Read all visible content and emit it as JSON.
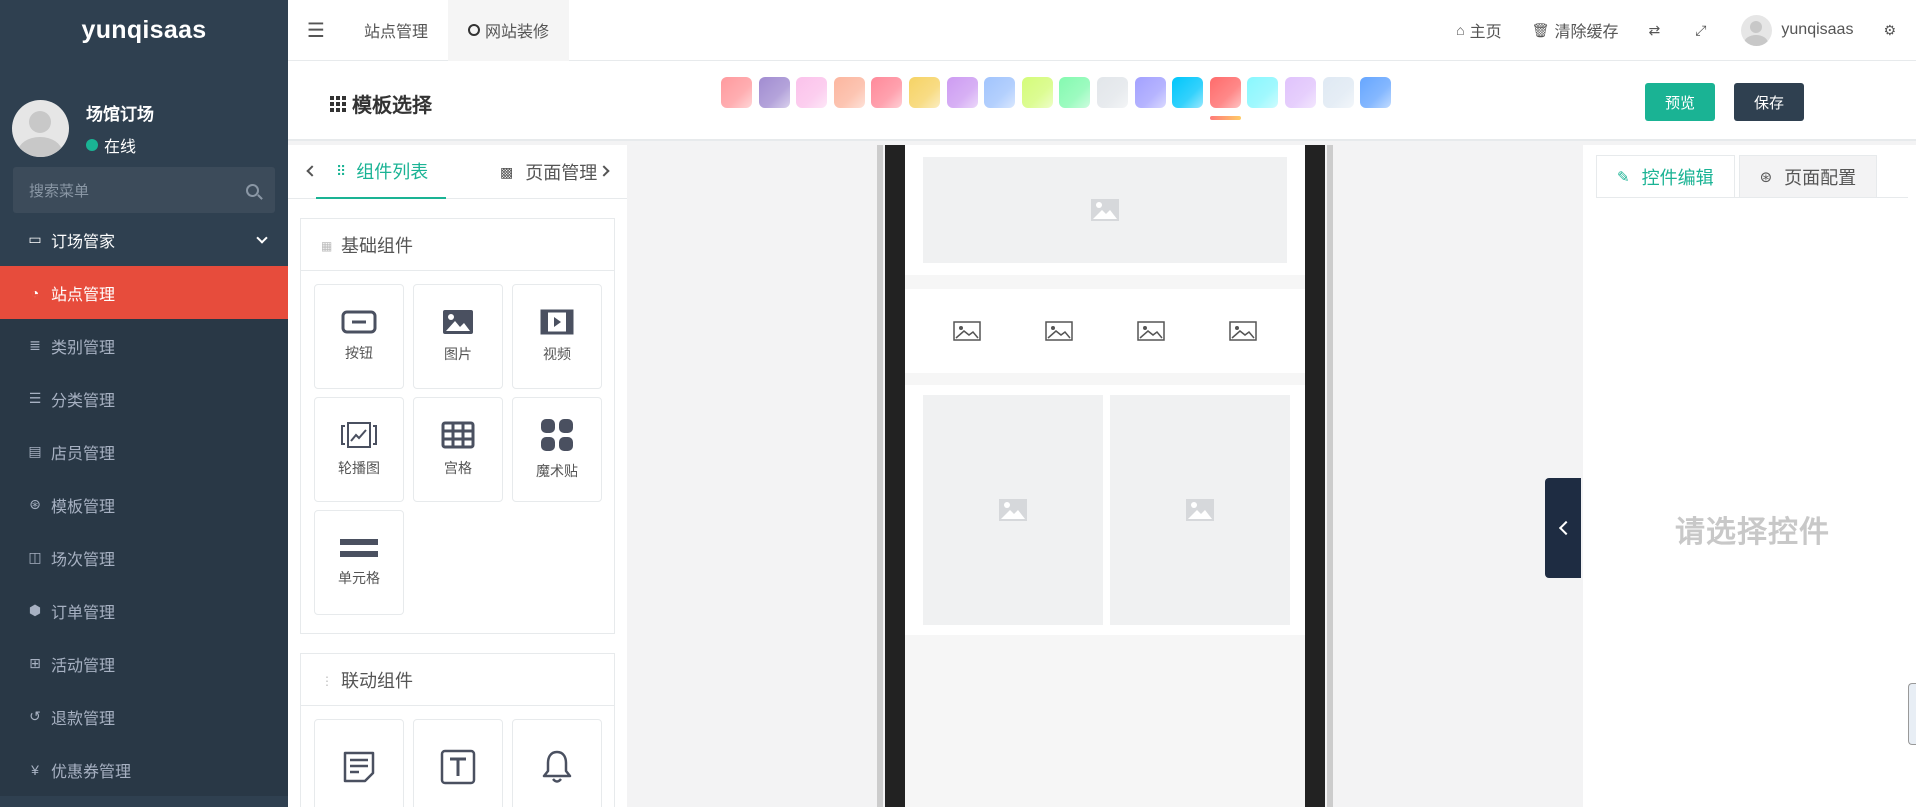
{
  "sidebar": {
    "brand": "yunqisaas",
    "user_name": "场馆订场",
    "status": "在线",
    "search_placeholder": "搜索菜单",
    "parent": {
      "label": "订场管家",
      "icon": "window-icon"
    },
    "items": [
      {
        "label": "站点管理",
        "icon": "dashboard-icon",
        "active": true
      },
      {
        "label": "类别管理",
        "icon": "align-icon"
      },
      {
        "label": "分类管理",
        "icon": "list-icon"
      },
      {
        "label": "店员管理",
        "icon": "id-card-icon"
      },
      {
        "label": "模板管理",
        "icon": "dribbble-icon"
      },
      {
        "label": "场次管理",
        "icon": "clone-icon"
      },
      {
        "label": "订单管理",
        "icon": "cube-icon"
      },
      {
        "label": "活动管理",
        "icon": "gift-icon"
      },
      {
        "label": "退款管理",
        "icon": "undo-icon"
      },
      {
        "label": "优惠券管理",
        "icon": "yen-icon"
      }
    ]
  },
  "topbar": {
    "tabs": [
      "站点管理",
      "网站装修"
    ],
    "home": "主页",
    "clear_cache": "清除缓存",
    "username": "yunqisaas"
  },
  "template": {
    "title": "模板选择",
    "preview": "预览",
    "save": "保存",
    "colors": [
      "#ff9a9e",
      "#a18cd1",
      "#fbc2eb",
      "#fcb69f",
      "#ff8a9a",
      "#f6d365",
      "#cd9cf2",
      "#a1c4fd",
      "#d4fc79",
      "#84fab0",
      "#e2e6ea",
      "#a3a1ff",
      "#00c6fb",
      "#ff6b6b",
      "#89f7fe",
      "#e0c3fc",
      "#dfe9f3",
      "#66a6ff"
    ],
    "selected_index": 13
  },
  "components": {
    "tab_list": "组件列表",
    "tab_pages": "页面管理",
    "basic_title": "基础组件",
    "basic": [
      {
        "label": "按钮",
        "icon": "button-icon"
      },
      {
        "label": "图片",
        "icon": "image-icon"
      },
      {
        "label": "视频",
        "icon": "video-icon"
      },
      {
        "label": "轮播图",
        "icon": "carousel-icon"
      },
      {
        "label": "宫格",
        "icon": "grid-icon"
      },
      {
        "label": "魔术贴",
        "icon": "magic-cube-icon"
      },
      {
        "label": "单元格",
        "icon": "cell-icon"
      }
    ],
    "linked_title": "联动组件",
    "linked": [
      {
        "label": "",
        "icon": "notes-icon"
      },
      {
        "label": "",
        "icon": "text-icon"
      },
      {
        "label": "",
        "icon": "bell-icon"
      }
    ]
  },
  "right_panel": {
    "tab_edit": "控件编辑",
    "tab_config": "页面配置",
    "placeholder": "请选择控件"
  }
}
